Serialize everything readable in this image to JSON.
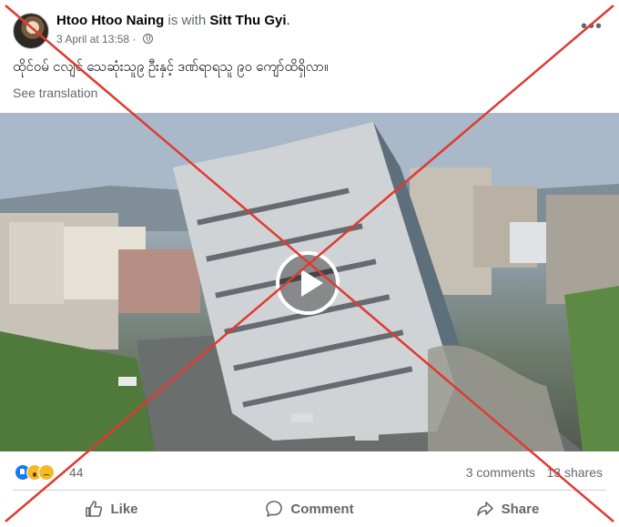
{
  "post": {
    "author": "Htoo Htoo Naing",
    "with_text": " is with ",
    "tagged": "Sitt Thu Gyi",
    "period": ".",
    "timestamp": "3 April at 13:58 · ",
    "text": "ထိုင်ဝမ် ငလျင် သေဆုံးသူ၉ ဦးနှင့် ဒဏ်ရာရသူ ၉၀ ကျော်ထိရှိလာ။",
    "see_translation": "See translation",
    "more_icon": "•••"
  },
  "stats": {
    "reaction_count": "44",
    "comments": "3 comments",
    "shares": "13 shares"
  },
  "actions": {
    "like": "Like",
    "comment": "Comment",
    "share": "Share"
  },
  "colors": {
    "x_mark": "#e03a2f",
    "like_blue": "#1877f2",
    "muted_text": "#65676b"
  }
}
